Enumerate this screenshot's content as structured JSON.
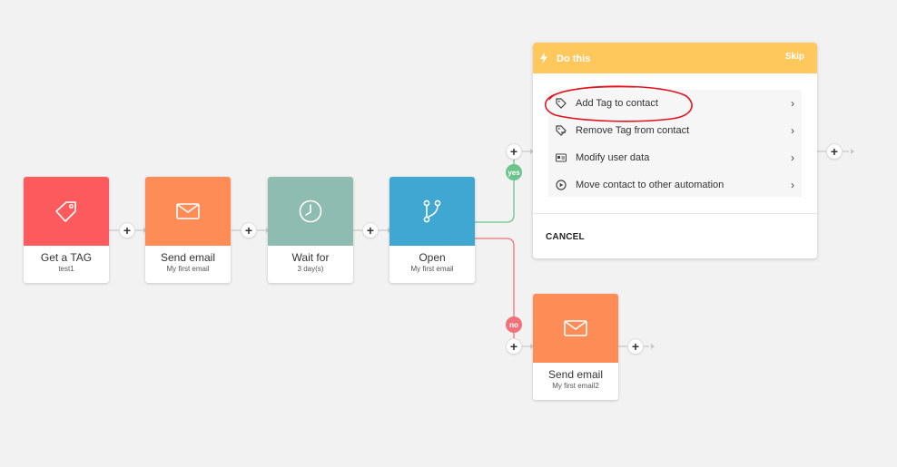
{
  "colors": {
    "tag": "#fd5a5d",
    "email": "#fe8c57",
    "wait": "#8fbcb0",
    "condition": "#40a7d2",
    "panel_header": "#fec85c",
    "yes": "#6cc48d",
    "no": "#f0717a",
    "annotation": "#e3141d"
  },
  "nodes": [
    {
      "title": "Get a TAG",
      "subtitle": "test1",
      "icon": "tag-icon"
    },
    {
      "title": "Send email",
      "subtitle": "My first email",
      "icon": "envelope-icon"
    },
    {
      "title": "Wait for",
      "subtitle": "3 day(s)",
      "icon": "clock-icon"
    },
    {
      "title": "Open",
      "subtitle": "My first email",
      "icon": "branch-icon"
    },
    {
      "title": "Send email",
      "subtitle": "My first email2",
      "icon": "envelope-icon"
    }
  ],
  "branches": {
    "yes": "yes",
    "no": "no"
  },
  "panel": {
    "title": "Do this",
    "skip": "Skip",
    "options": [
      {
        "label": "Add Tag to contact",
        "icon": "tag-add-icon"
      },
      {
        "label": "Remove Tag from contact",
        "icon": "tag-remove-icon"
      },
      {
        "label": "Modify user data",
        "icon": "id-card-icon"
      },
      {
        "label": "Move contact to other automation",
        "icon": "play-circle-icon"
      }
    ],
    "cancel": "CANCEL"
  },
  "plus_symbol": "+"
}
